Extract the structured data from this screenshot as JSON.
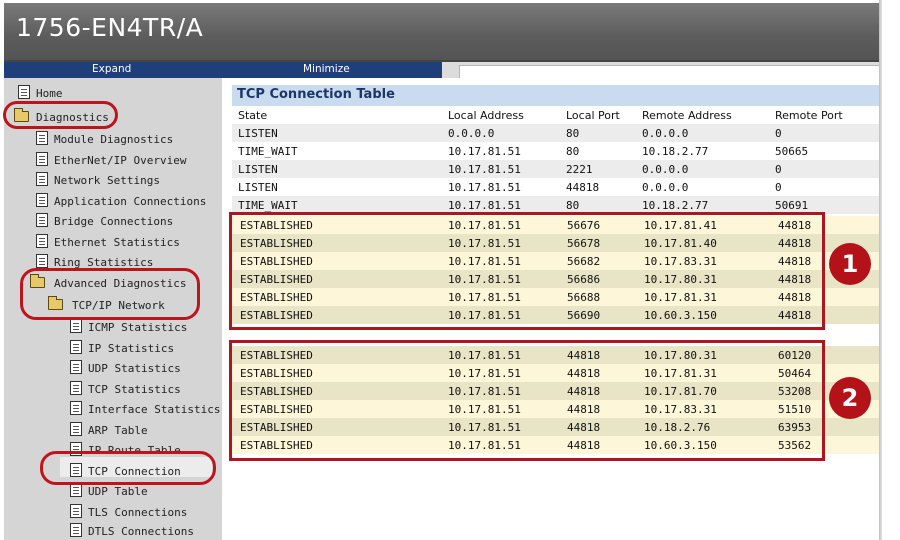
{
  "window": {
    "title": "1756-EN4TR/A"
  },
  "nav": {
    "expand_label": "Expand",
    "minimize_label": "Minimize"
  },
  "sidebar": {
    "items": [
      {
        "label": "Home",
        "type": "doc"
      },
      {
        "label": "Diagnostics",
        "type": "folder"
      },
      {
        "label": "Module Diagnostics",
        "type": "doc"
      },
      {
        "label": "EtherNet/IP Overview",
        "type": "doc"
      },
      {
        "label": "Network Settings",
        "type": "doc"
      },
      {
        "label": "Application Connections",
        "type": "doc"
      },
      {
        "label": "Bridge Connections",
        "type": "doc"
      },
      {
        "label": "Ethernet Statistics",
        "type": "doc"
      },
      {
        "label": "Ring Statistics",
        "type": "doc"
      },
      {
        "label": "Advanced Diagnostics",
        "type": "folder"
      },
      {
        "label": "TCP/IP Network",
        "type": "folder"
      },
      {
        "label": "ICMP Statistics",
        "type": "doc"
      },
      {
        "label": "IP Statistics",
        "type": "doc"
      },
      {
        "label": "UDP Statistics",
        "type": "doc"
      },
      {
        "label": "TCP Statistics",
        "type": "doc"
      },
      {
        "label": "Interface Statistics",
        "type": "doc"
      },
      {
        "label": "ARP Table",
        "type": "doc"
      },
      {
        "label": "IP Route Table",
        "type": "doc"
      },
      {
        "label": "TCP Connection",
        "type": "doc",
        "selected": true
      },
      {
        "label": "UDP Table",
        "type": "doc"
      },
      {
        "label": "TLS Connections",
        "type": "doc"
      },
      {
        "label": "DTLS Connections",
        "type": "doc"
      }
    ]
  },
  "table": {
    "title": "TCP Connection Table",
    "columns": [
      "State",
      "Local Address",
      "Local Port",
      "Remote Address",
      "Remote Port"
    ],
    "rows": [
      [
        "LISTEN",
        "0.0.0.0",
        "80",
        "0.0.0.0",
        "0"
      ],
      [
        "TIME_WAIT",
        "10.17.81.51",
        "80",
        "10.18.2.77",
        "50665"
      ],
      [
        "LISTEN",
        "10.17.81.51",
        "2221",
        "0.0.0.0",
        "0"
      ],
      [
        "LISTEN",
        "10.17.81.51",
        "44818",
        "0.0.0.0",
        "0"
      ],
      [
        "TIME_WAIT",
        "10.17.81.51",
        "80",
        "10.18.2.77",
        "50691"
      ]
    ],
    "group1": [
      [
        "ESTABLISHED",
        "10.17.81.51",
        "56676",
        "10.17.81.41",
        "44818"
      ],
      [
        "ESTABLISHED",
        "10.17.81.51",
        "56678",
        "10.17.81.40",
        "44818"
      ],
      [
        "ESTABLISHED",
        "10.17.81.51",
        "56682",
        "10.17.83.31",
        "44818"
      ],
      [
        "ESTABLISHED",
        "10.17.81.51",
        "56686",
        "10.17.80.31",
        "44818"
      ],
      [
        "ESTABLISHED",
        "10.17.81.51",
        "56688",
        "10.17.81.31",
        "44818"
      ],
      [
        "ESTABLISHED",
        "10.17.81.51",
        "56690",
        "10.60.3.150",
        "44818"
      ]
    ],
    "group2": [
      [
        "ESTABLISHED",
        "10.17.81.51",
        "44818",
        "10.17.80.31",
        "60120"
      ],
      [
        "ESTABLISHED",
        "10.17.81.51",
        "44818",
        "10.17.81.31",
        "50464"
      ],
      [
        "ESTABLISHED",
        "10.17.81.51",
        "44818",
        "10.17.81.70",
        "53208"
      ],
      [
        "ESTABLISHED",
        "10.17.81.51",
        "44818",
        "10.17.83.31",
        "51510"
      ],
      [
        "ESTABLISHED",
        "10.17.81.51",
        "44818",
        "10.18.2.76",
        "63953"
      ],
      [
        "ESTABLISHED",
        "10.17.81.51",
        "44818",
        "10.60.3.150",
        "53562"
      ]
    ]
  },
  "callouts": {
    "badge1": "1",
    "badge2": "2"
  },
  "colors": {
    "title_bar": "#5c5c5c",
    "nav_bar": "#1f3f7a",
    "table_title_bg": "#c9dcef",
    "highlight_red": "#b0141c",
    "established_row": "#fdf6d8"
  }
}
